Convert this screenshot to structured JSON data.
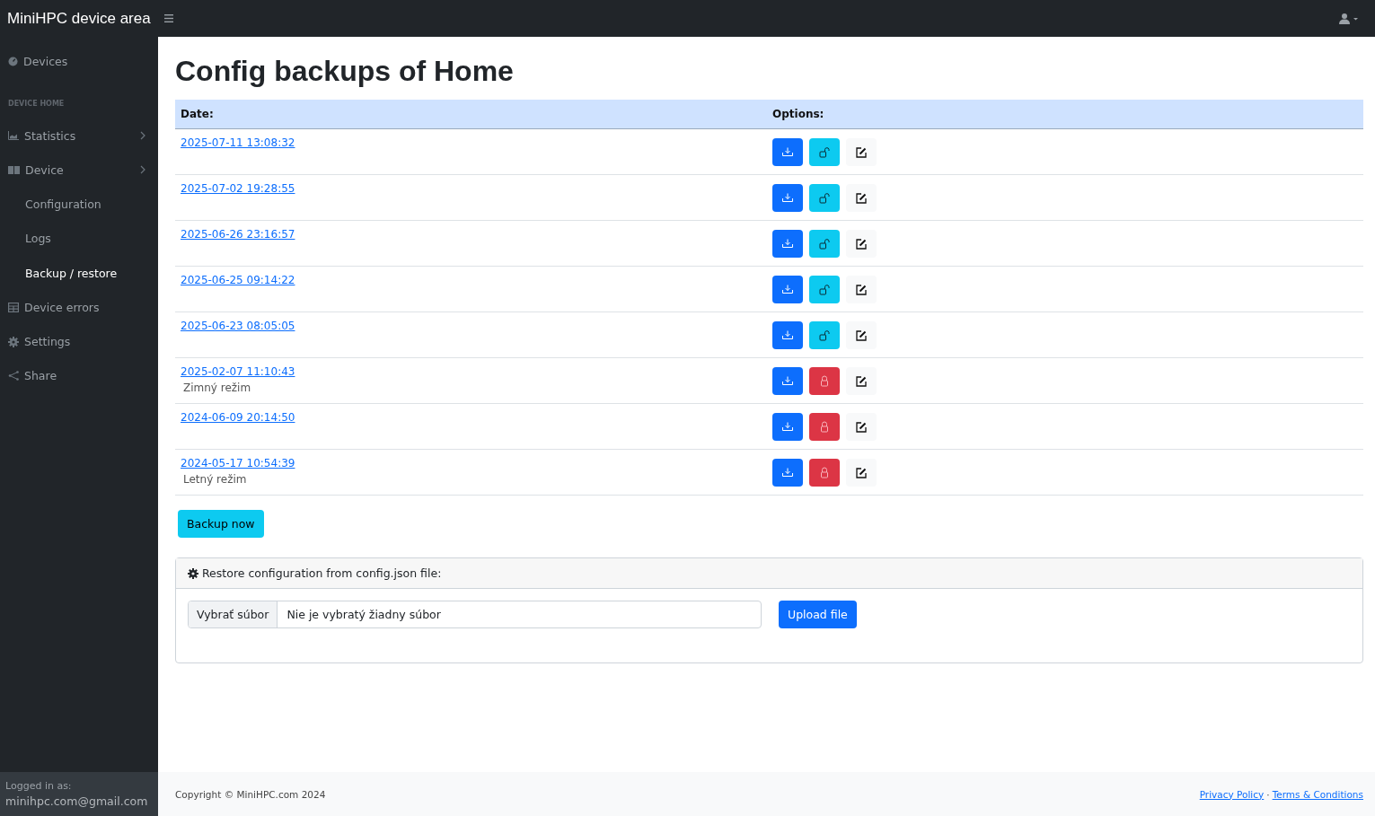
{
  "topbar": {
    "brand": "MiniHPC device area"
  },
  "sidebar": {
    "items": [
      {
        "kind": "link",
        "label": "Devices",
        "selected": false,
        "has_submenu": false
      },
      {
        "kind": "heading",
        "label": "DEVICE HOME"
      },
      {
        "kind": "link",
        "label": "Statistics",
        "selected": false,
        "has_submenu": true
      },
      {
        "kind": "link",
        "label": "Device",
        "selected": false,
        "has_submenu": true
      },
      {
        "kind": "sub",
        "label": "Configuration",
        "selected": false
      },
      {
        "kind": "sub",
        "label": "Logs",
        "selected": false
      },
      {
        "kind": "sub",
        "label": "Backup / restore",
        "selected": true
      },
      {
        "kind": "link",
        "label": "Device errors",
        "selected": false,
        "has_submenu": false
      },
      {
        "kind": "link",
        "label": "Settings",
        "selected": false,
        "has_submenu": false
      },
      {
        "kind": "link",
        "label": "Share",
        "selected": false,
        "has_submenu": false
      }
    ],
    "login": {
      "label": "Logged in as:",
      "user": "minihpc.com@gmail.com"
    }
  },
  "page": {
    "title": "Config backups of Home"
  },
  "table": {
    "columns": [
      "Date:",
      "Options:"
    ],
    "rows": [
      {
        "date": "2025-07-11 13:08:32",
        "locked": false
      },
      {
        "date": "2025-07-02 19:28:55",
        "locked": false
      },
      {
        "date": "2025-06-26 23:16:57",
        "locked": false
      },
      {
        "date": "2025-06-25 09:14:22",
        "locked": false
      },
      {
        "date": "2025-06-23 08:05:05",
        "locked": false
      },
      {
        "date": "2025-02-07 11:10:43",
        "note": "Zimný režim",
        "locked": true
      },
      {
        "date": "2024-06-09 20:14:50",
        "locked": true
      },
      {
        "date": "2024-05-17 10:54:39",
        "note": "Letný režim",
        "locked": true
      }
    ]
  },
  "backup_button": "Backup now",
  "restore": {
    "title": "Restore configuration from config.json file:",
    "choose_button": "Vybrať súbor",
    "file_status": "Nie je vybratý žiadny súbor",
    "upload_button": "Upload file"
  },
  "footer": {
    "copyright": "Copyright © MiniHPC.com 2024",
    "links": [
      "Privacy Policy",
      "Terms & Conditions"
    ],
    "separator": "·"
  }
}
